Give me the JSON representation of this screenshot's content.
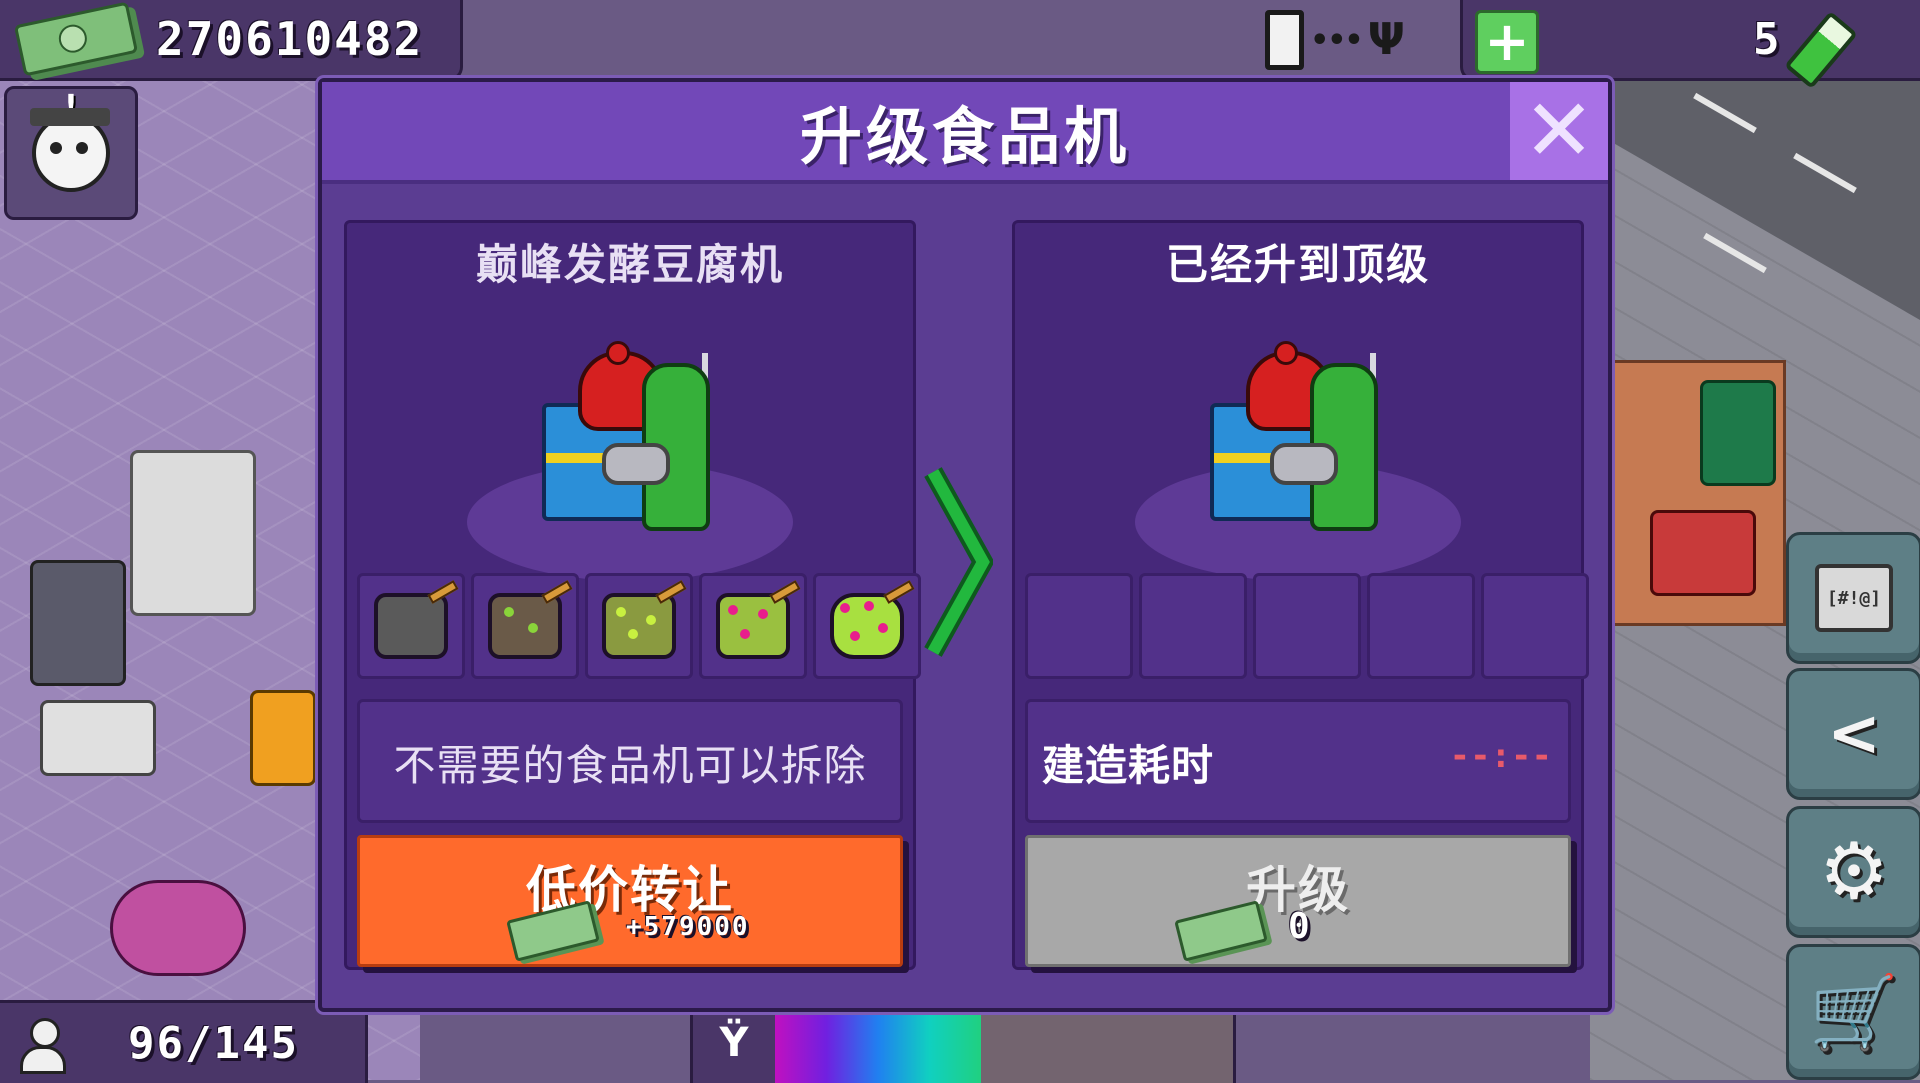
{
  "hud": {
    "money": "270610482",
    "energy": "5",
    "population": "96/145",
    "mood_level": 0.45
  },
  "dialog": {
    "title": "升级食品机",
    "close_symbol": "✕",
    "current": {
      "name": "巅峰发酵豆腐机",
      "hint": "不需要的食品机可以拆除",
      "sell_label": "低价转让",
      "sell_amount": "+579000",
      "ingredients": [
        "tofu-plain",
        "tofu-sprout",
        "tofu-mossy",
        "tofu-blooming",
        "tofu-flowering"
      ]
    },
    "next": {
      "name": "已经升到顶级",
      "build_time_label": "建造耗时",
      "build_time_value": "--:--",
      "upgrade_label": "升级",
      "upgrade_cost": "0",
      "empty_slots": 5
    }
  },
  "side_buttons": [
    "gift-icon",
    "share-icon",
    "settings-gear-icon",
    "shop-cart-icon"
  ],
  "gift_tag": "[#!@]",
  "colors": {
    "sell_button": "#ff6a2c",
    "upgrade_button_disabled": "#a8a8a8",
    "dialog_bg": "#5b3d92",
    "title_bar": "#7248b8",
    "close_button": "#a871e6",
    "arrow": "#1eae3a"
  }
}
